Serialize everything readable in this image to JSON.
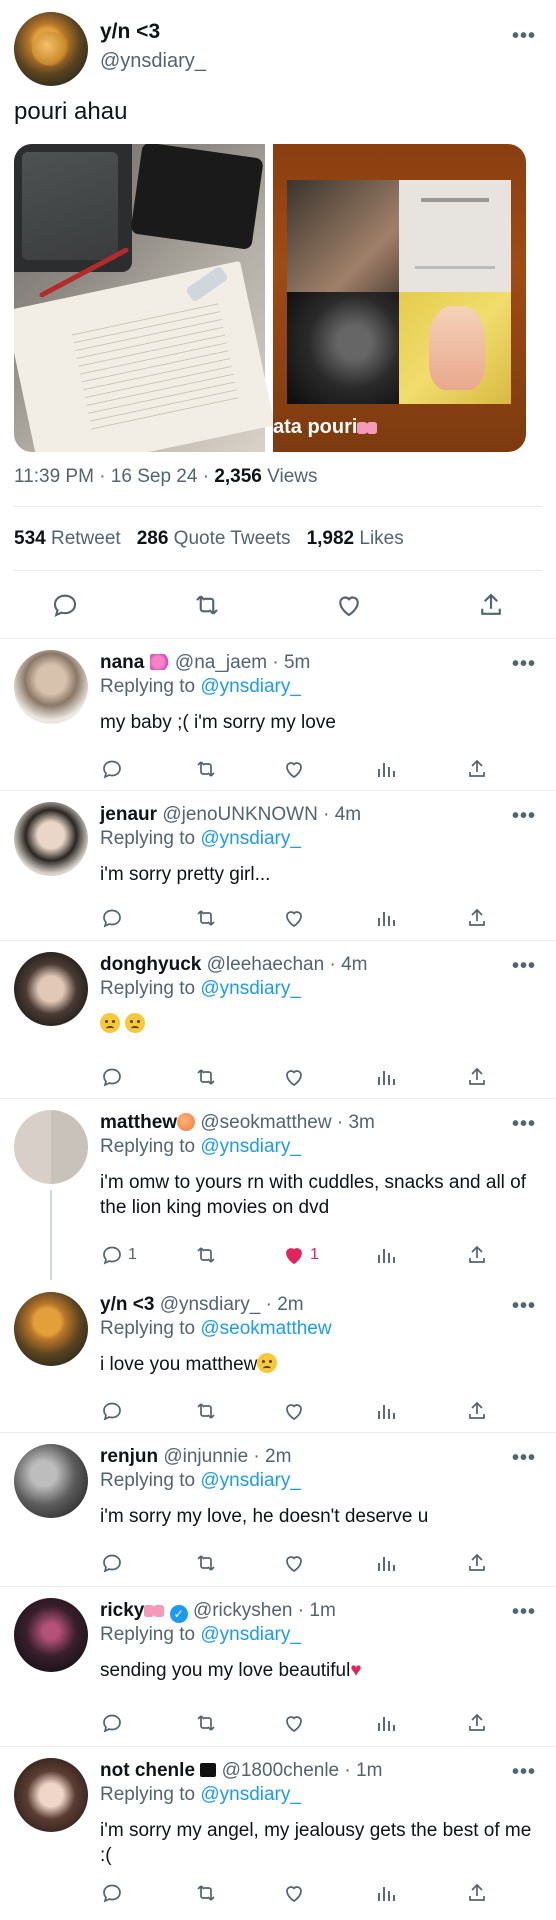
{
  "main_tweet": {
    "name": "y/n <3",
    "handle": "@ynsdiary_",
    "text": "pouri ahau",
    "media_overlay": "ata pouri",
    "time": "11:39 PM · 16 Sep 24 · ",
    "views_count": "2,356",
    "views_label": " Views",
    "retweets": {
      "count": "534",
      "label": " Retweet"
    },
    "quotes": {
      "count": "286",
      "label": " Quote Tweets"
    },
    "likes": {
      "count": "1,982",
      "label": " Likes"
    },
    "more_glyph": "•••"
  },
  "replying_to_label": "Replying to ",
  "replies": [
    {
      "name": "nana",
      "handle": "@na_jaem",
      "time": "5m",
      "replying_to": "@ynsdiary_",
      "text": "my baby ;( i'm sorry my love"
    },
    {
      "name": "jenaur",
      "handle": "@jenoUNKNOWN",
      "time": "4m",
      "replying_to": "@ynsdiary_",
      "text": "i'm sorry pretty girl..."
    },
    {
      "name": "donghyuck",
      "handle": "@leehaechan",
      "time": "4m",
      "replying_to": "@ynsdiary_",
      "text": ""
    },
    {
      "name": "matthew",
      "handle": "@seokmatthew",
      "time": "3m",
      "replying_to": "@ynsdiary_",
      "text": "i'm omw to yours rn with cuddles, snacks and all of the lion king movies on dvd",
      "reply_count": "1",
      "like_count": "1"
    },
    {
      "name": "y/n <3",
      "handle": "@ynsdiary_",
      "time": "2m",
      "replying_to": "@seokmatthew",
      "text": "i love you matthew"
    },
    {
      "name": "renjun",
      "handle": "@injunnie",
      "time": "2m",
      "replying_to": "@ynsdiary_",
      "text": "i'm sorry my love, he doesn't deserve u"
    },
    {
      "name": "ricky",
      "handle": "@rickyshen",
      "time": "1m",
      "replying_to": "@ynsdiary_",
      "text": "sending you my love beautiful"
    },
    {
      "name": "not chenle",
      "handle": "@1800chenle",
      "time": "1m",
      "replying_to": "@ynsdiary_",
      "text": "i'm sorry my angel, my jealousy gets the best of me :("
    }
  ],
  "colors": {
    "link": "#1d9bf0",
    "secondary": "#536471",
    "like": "#e0245e",
    "divider": "#e6ecf0"
  },
  "icons": [
    "reply-icon",
    "retweet-icon",
    "like-icon",
    "views-icon",
    "share-icon",
    "more-icon"
  ]
}
